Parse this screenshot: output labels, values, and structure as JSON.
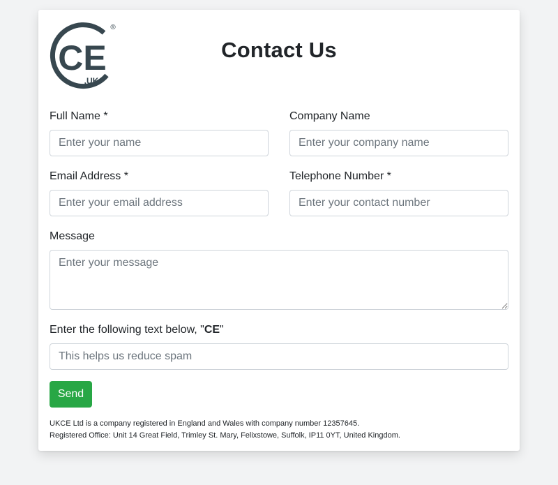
{
  "logo": {
    "text": "CE",
    "subtext": ".UK",
    "registered": "®",
    "color": "#37474f"
  },
  "title": "Contact Us",
  "fields": {
    "full_name": {
      "label": "Full Name *",
      "placeholder": "Enter your name"
    },
    "company_name": {
      "label": "Company Name",
      "placeholder": "Enter your company name"
    },
    "email": {
      "label": "Email Address *",
      "placeholder": "Enter your email address"
    },
    "telephone": {
      "label": "Telephone Number *",
      "placeholder": "Enter your contact number"
    },
    "message": {
      "label": "Message",
      "placeholder": "Enter your message"
    },
    "captcha": {
      "label_prefix": "Enter the following text below, \"",
      "label_code": "CE",
      "label_suffix": "\"",
      "placeholder": "This helps us reduce spam"
    }
  },
  "send_button": {
    "label": "Send",
    "color": "#28a745"
  },
  "footer": {
    "line1": "UKCE Ltd is a company registered in England and Wales with company number 12357645.",
    "line2": "Registered Office: Unit 14 Great Field, Trimley St. Mary, Felixstowe, Suffolk, IP11 0YT, United Kingdom."
  }
}
